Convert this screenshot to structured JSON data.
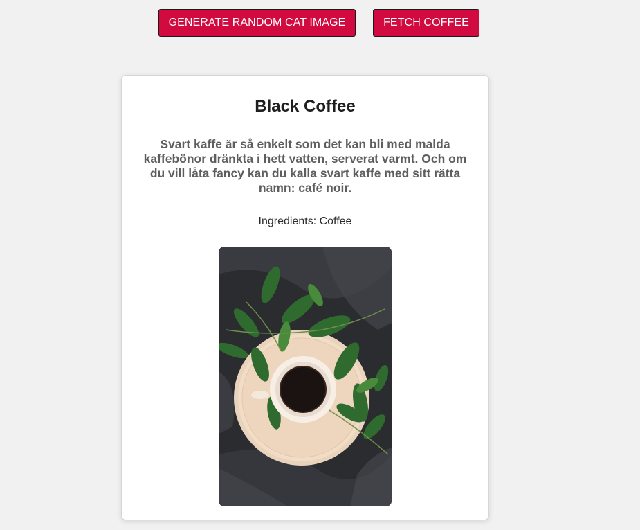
{
  "toolbar": {
    "cat_button_label": "GENERATE RANDOM CAT IMAGE",
    "coffee_button_label": "FETCH COFFEE"
  },
  "coffee_card": {
    "title": "Black Coffee",
    "description": "Svart kaffe är så enkelt som det kan bli med malda kaffebönor dränkta i hett vatten, serverat varmt. Och om du vill låta fancy kan du kalla svart kaffe med sitt rätta namn: café noir.",
    "ingredients": "Ingredients: Coffee",
    "image": {
      "subject": "coffee-cup-on-wooden-tray-with-leaves"
    }
  },
  "colors": {
    "button_background": "#d10a3f",
    "button_text": "#ffffff",
    "page_background": "#f1f1f1",
    "card_background": "#ffffff"
  }
}
